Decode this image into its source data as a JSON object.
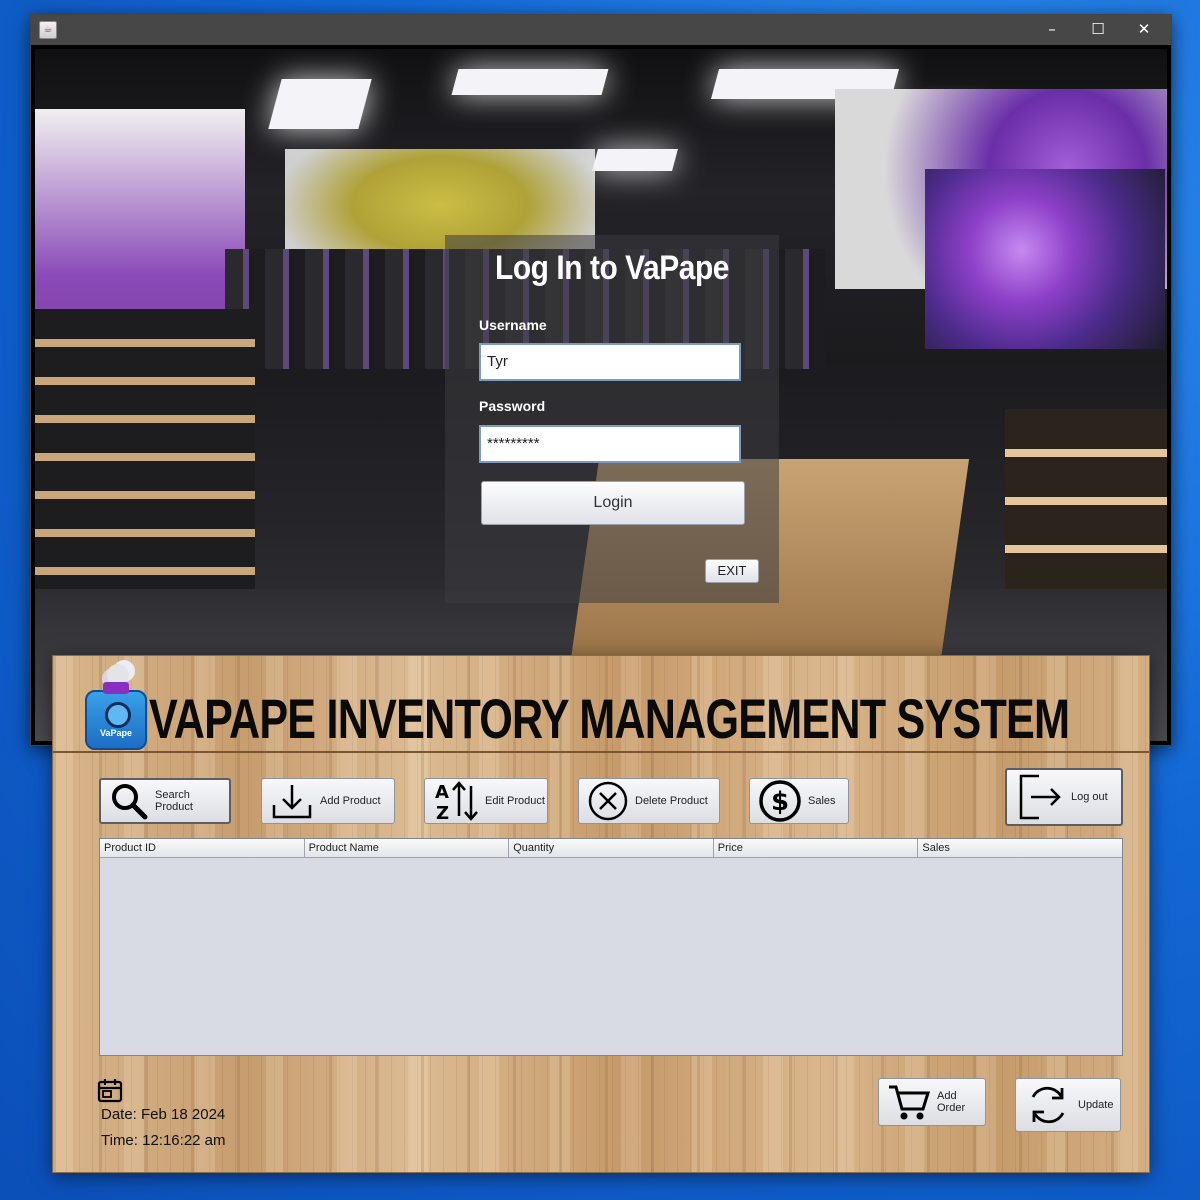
{
  "login_window": {
    "title_bar": {
      "app_icon": "java-icon",
      "minimize": "–",
      "maximize": "☐",
      "close": "✕"
    },
    "panel": {
      "title": "Log In to VaPape",
      "username_label": "Username",
      "username_value": "Tyr",
      "password_label": "Password",
      "password_value": "*********",
      "login_button": "Login",
      "exit_button": "EXIT"
    }
  },
  "inventory_window": {
    "logo_text": "VaPape",
    "title": "VAPAPE INVENTORY MANAGEMENT SYSTEM",
    "toolbar": [
      {
        "label": "Search Product",
        "icon": "search-icon"
      },
      {
        "label": "Add Product",
        "icon": "download-icon"
      },
      {
        "label": "Edit Product",
        "icon": "sort-az-icon"
      },
      {
        "label": "Delete Product",
        "icon": "delete-circle-icon"
      },
      {
        "label": "Sales",
        "icon": "dollar-icon"
      }
    ],
    "logout_button": "Log out",
    "table": {
      "columns": [
        "Product ID",
        "Product Name",
        "Quantity",
        "Price",
        "Sales"
      ],
      "rows": []
    },
    "date_text": "Date: Feb 18 2024",
    "time_text": "Time: 12:16:22 am",
    "add_order_button": "Add  Order",
    "update_button": "Update"
  }
}
